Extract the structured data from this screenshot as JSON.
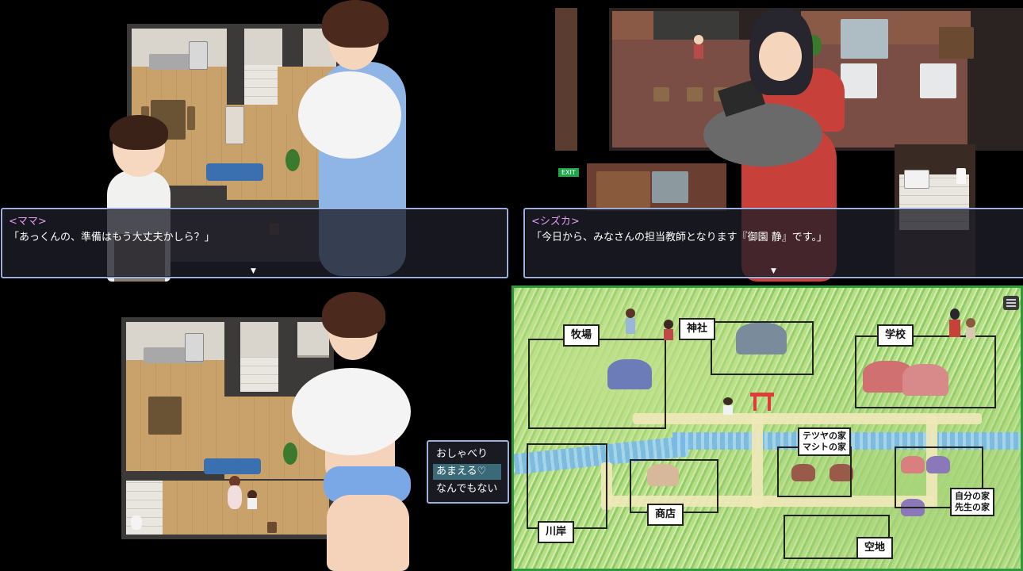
{
  "panels": {
    "top_left": {
      "dialogue": {
        "speaker": "<ママ>",
        "text": "「あっくんの、準備はもう大丈夫かしら？」",
        "continue_icon": "triangle-down-icon"
      }
    },
    "top_right": {
      "exit_sign": "EXIT",
      "dialogue": {
        "speaker": "<シズカ>",
        "text": "「今日から、みなさんの担当教師となります『御園 静』です。」",
        "continue_icon": "triangle-down-icon"
      }
    },
    "bottom_left": {
      "choices": [
        "おしゃべり",
        "あまえる♡",
        "なんでもない"
      ],
      "selected_index": 1
    },
    "bottom_right": {
      "menu_icon": "hamburger-menu-icon",
      "locations": {
        "ranch": "牧場",
        "shrine": "神社",
        "school": "学校",
        "tetsuya_house_1": "テツヤの家",
        "tetsuya_house_2": "マシトの家",
        "riverside": "川岸",
        "shop": "商店",
        "my_house_1": "自分の家",
        "my_house_2": "先生の家",
        "vacant_lot": "空地"
      }
    }
  },
  "colors": {
    "name_color": "#e79bf2",
    "window_border": "#9cb0dd",
    "selected_choice": "#3a6a78",
    "floor": "#c8a26a",
    "map_grass": "#8fcb68"
  }
}
